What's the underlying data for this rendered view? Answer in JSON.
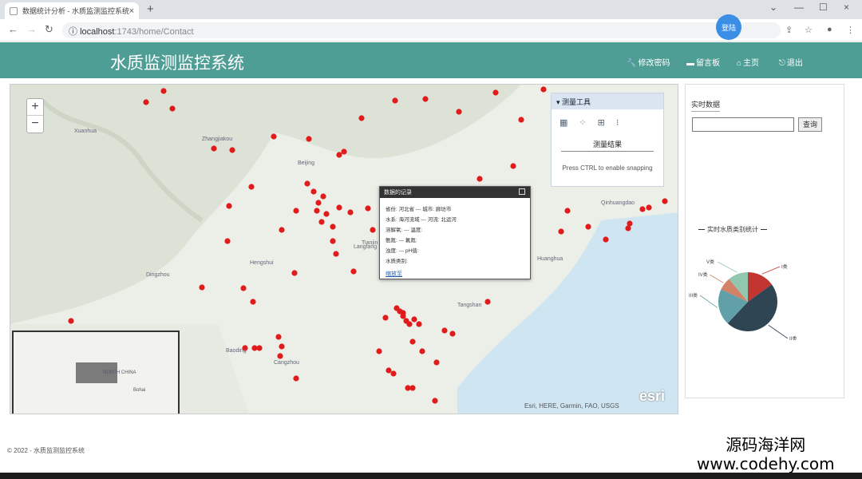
{
  "browser": {
    "tab_title": "数据统计分析 - 水质监测监控系统",
    "tab_close": "×",
    "new_tab": "+",
    "url_host": "localhost",
    "url_path": ":1743/home/Contact",
    "avatar_text": "登陆",
    "window_controls": [
      "—",
      "☐",
      "×"
    ]
  },
  "header": {
    "brand": "水质监测监控系统",
    "nav": [
      {
        "label": "修改密码",
        "icon": "wrench-icon"
      },
      {
        "label": "留言板",
        "icon": "comment-icon"
      },
      {
        "label": "主页",
        "icon": "home-icon"
      },
      {
        "label": "退出",
        "icon": "logout-icon"
      }
    ]
  },
  "map": {
    "zoom_in": "+",
    "zoom_out": "−",
    "attribution": "Esri, HERE, Garmin, FAO, USGS",
    "logo": "esri",
    "labels": [
      {
        "text": "Xuanhua"
      },
      {
        "text": "Zhangjiakou"
      },
      {
        "text": "Beijing"
      },
      {
        "text": "Tianjin"
      },
      {
        "text": "Langfang"
      },
      {
        "text": "Baoding"
      },
      {
        "text": "Cangzhou"
      },
      {
        "text": "Tangshan"
      },
      {
        "text": "Qinhuangdao"
      },
      {
        "text": "Huanghua"
      },
      {
        "text": "Hengshui"
      },
      {
        "text": "Dingzhou"
      }
    ],
    "measure": {
      "title": "测量工具",
      "result": "测量结果",
      "hint": "Press CTRL to enable snapping"
    },
    "popup": {
      "title": "数据的记录",
      "lines": [
        "省份: 河北省 --- 城市: 廊坊市",
        "水系: 海河流域 --- 河流: 北运河",
        "溶解氧: --- 温度:",
        "氨氮: --- 氟氮:",
        "浊度: --- pH值:",
        "水质类别:"
      ],
      "link": "缩放至"
    },
    "inset_labels": [
      "NORTH CHINA",
      "Bohai"
    ]
  },
  "side": {
    "title": "实时数据",
    "search_button": "查询",
    "search_value": "",
    "chart_title": "实时水质类别统计"
  },
  "chart_data": {
    "type": "pie",
    "title": "实时水质类别统计",
    "slices": [
      {
        "label": "I类",
        "value": 15,
        "color": "#c23531"
      },
      {
        "label": "II类",
        "value": 47,
        "color": "#2f4554"
      },
      {
        "label": "III类",
        "value": 20,
        "color": "#61a0a8"
      },
      {
        "label": "IV类",
        "value": 7,
        "color": "#d48265"
      },
      {
        "label": "V类",
        "value": 11,
        "color": "#91c7ae"
      }
    ]
  },
  "footer": {
    "text": "© 2022 - 水质监测监控系统"
  },
  "watermark": {
    "line1": "源码海洋网",
    "line2": "www.codehy.com"
  }
}
